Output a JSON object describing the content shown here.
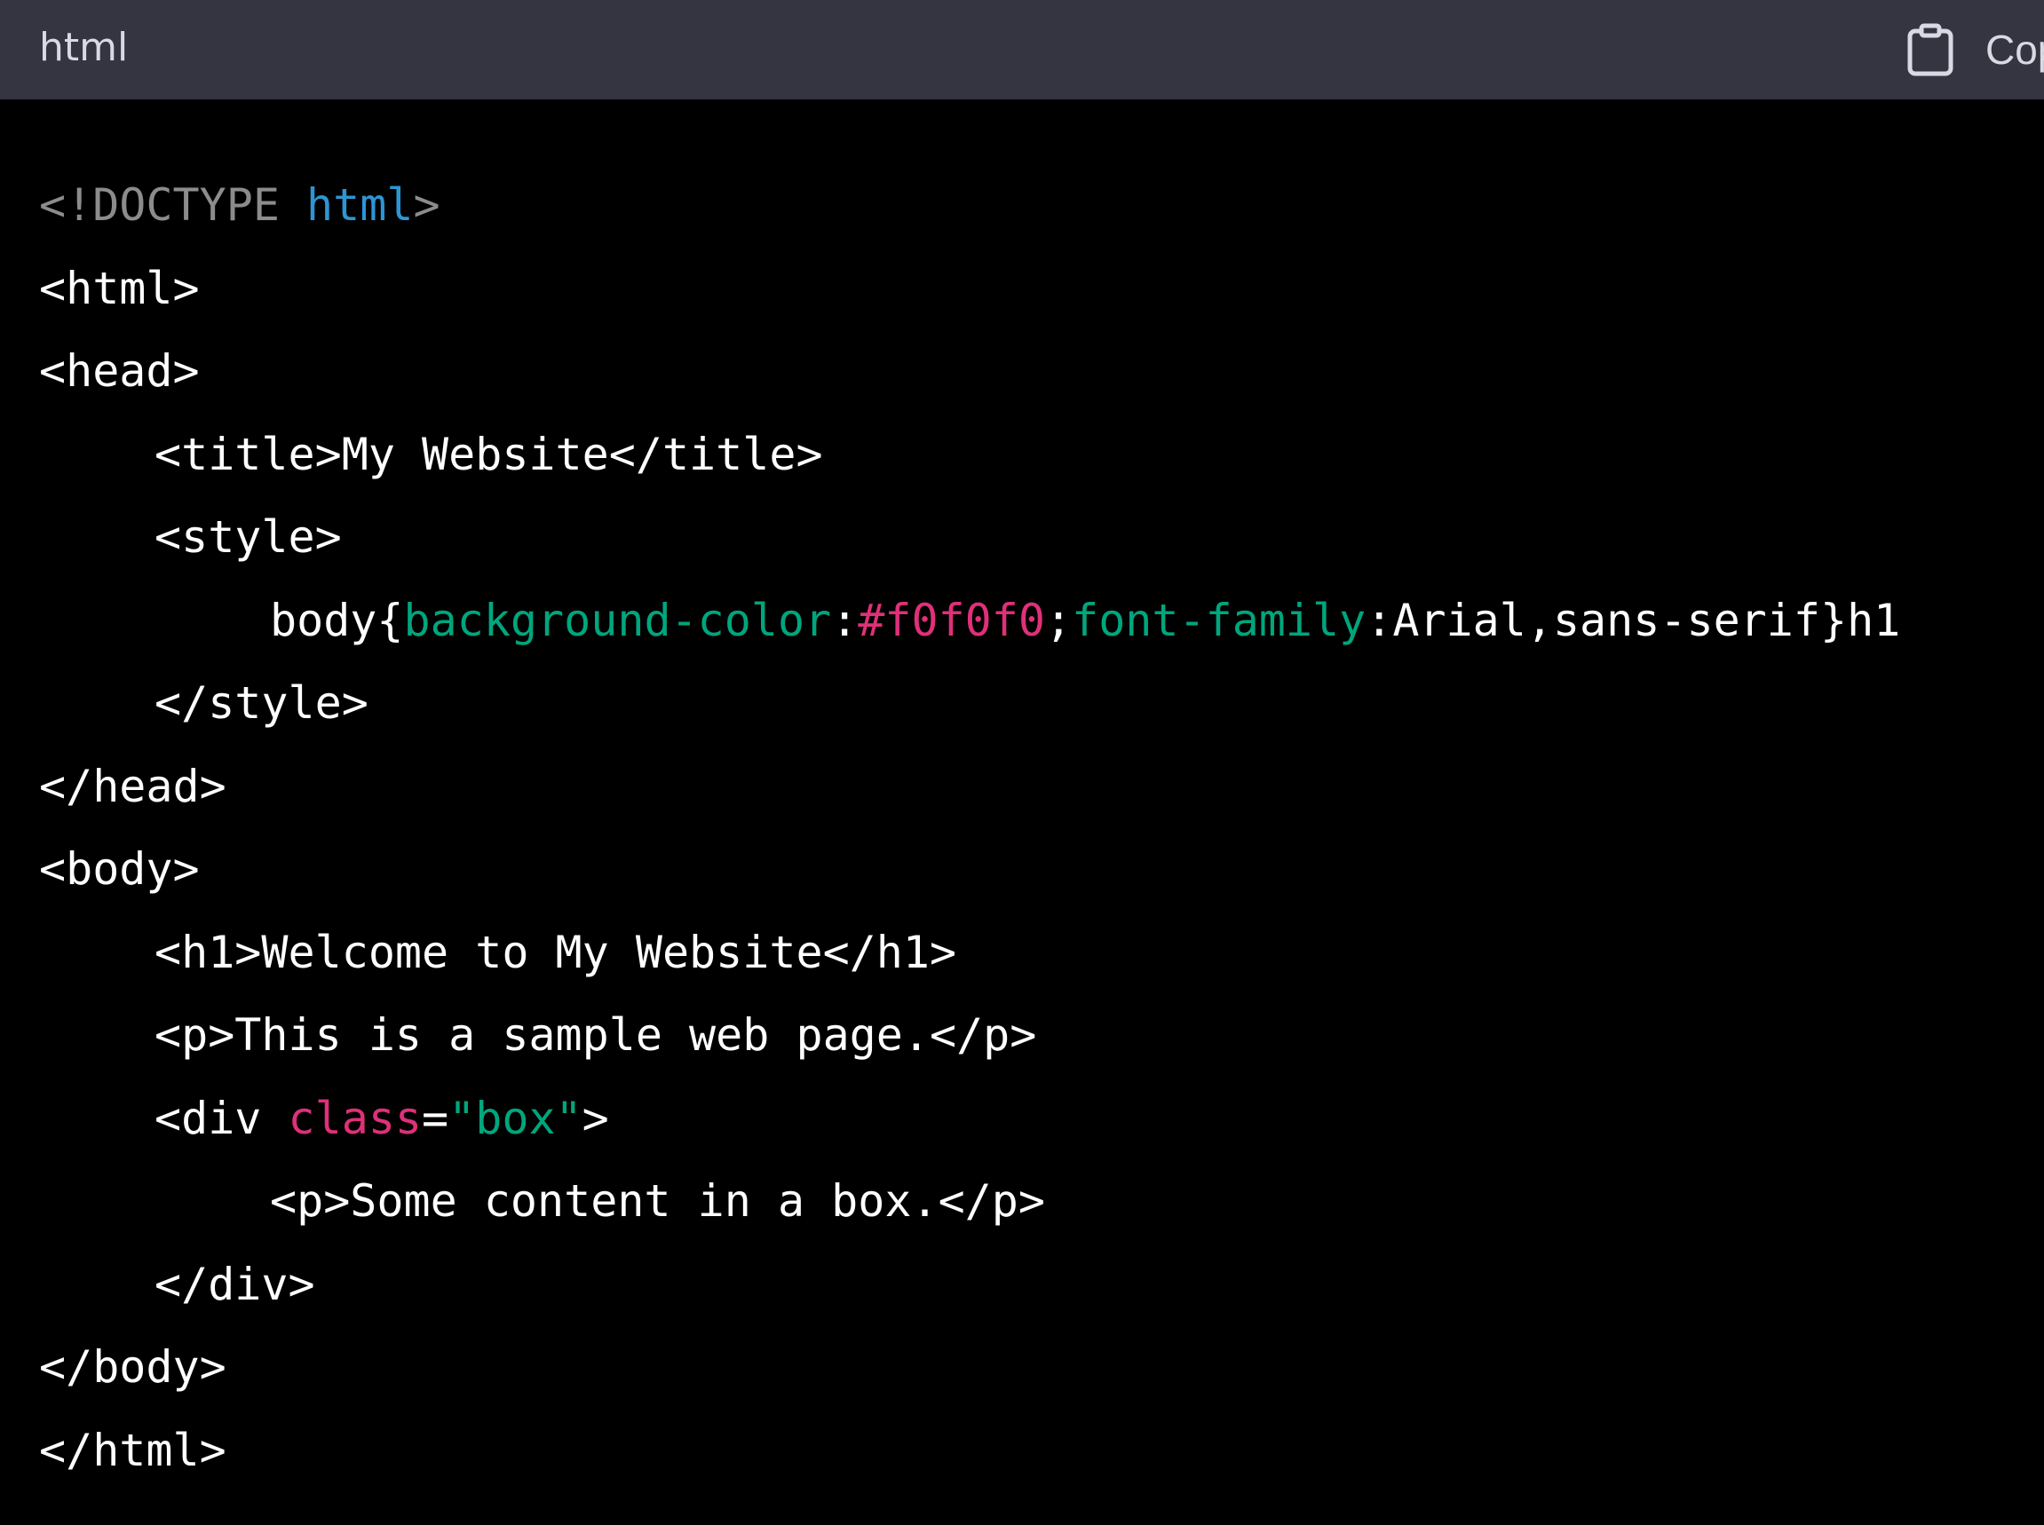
{
  "header": {
    "language": "html",
    "copy_label": "Copy code",
    "copy_icon": "clipboard-icon"
  },
  "colors": {
    "header_bg": "#343541",
    "code_bg": "#000000",
    "doctype": "#8c8c8c",
    "keyword": "#2e95d3",
    "css_property": "#00a67d",
    "css_value": "#df3079",
    "attribute": "#df3079",
    "string": "#00a67d",
    "text": "#ffffff"
  },
  "code": {
    "l1": {
      "a": "<!DOCTYPE ",
      "b": "html",
      "c": ">"
    },
    "l2": "<html>",
    "l3": "<head>",
    "l4": "<title>My Website</title>",
    "l5": "<style>",
    "l6": {
      "a": "body{",
      "b": "background-color",
      "c": ":",
      "d": "#f0f0f0",
      "e": ";",
      "f": "font-family",
      "g": ":Arial,sans-serif}h1"
    },
    "l7": "</style>",
    "l8": "</head>",
    "l9": "<body>",
    "l10": "<h1>Welcome to My Website</h1>",
    "l11": "<p>This is a sample web page.</p>",
    "l12": {
      "a": "<div ",
      "b": "class",
      "c": "=",
      "d": "\"box\"",
      "e": ">"
    },
    "l13": "<p>Some content in a box.</p>",
    "l14": "</div>",
    "l15": "</body>",
    "l16": "</html>"
  }
}
